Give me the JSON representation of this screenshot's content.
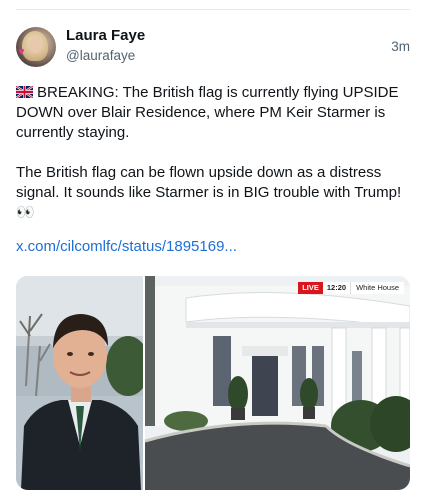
{
  "post": {
    "author_name": "Laura Faye",
    "author_handle": "@laurafaye",
    "timestamp": "3m",
    "paragraph_1": "BREAKING: The British flag is currently flying UPSIDE DOWN over Blair Residence, where PM Keir Starmer is currently staying.",
    "paragraph_2": "The British flag can be flown upside down as a distress signal. It sounds like Starmer is in BIG trouble with Trump! 👀",
    "link_text": "x.com/cilcomlfc/status/1895169..."
  },
  "media": {
    "live_label": "LIVE",
    "live_time": "12:20",
    "live_location": "White House"
  },
  "colors": {
    "link": "#1d6fd6",
    "secondary_text": "#536471",
    "live_red": "#d9161b"
  }
}
